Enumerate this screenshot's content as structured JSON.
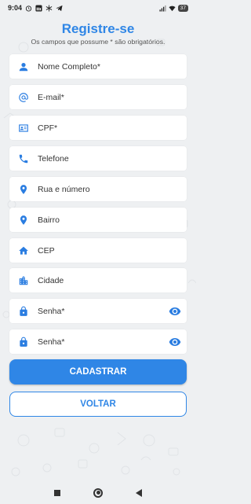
{
  "status_bar": {
    "time": "9:04",
    "left_icons": [
      "alarm-icon",
      "linkedin-icon",
      "snowflake-icon",
      "telegram-icon"
    ],
    "right_icons": [
      "signal-icon",
      "wifi-icon"
    ],
    "battery": "37"
  },
  "header": {
    "title": "Registre-se",
    "subtitle": "Os campos que possume * são obrigatórios."
  },
  "fields": [
    {
      "label": "Nome Completo*",
      "icon": "person-icon"
    },
    {
      "label": "E-mail*",
      "icon": "at-icon"
    },
    {
      "label": "CPF*",
      "icon": "id-card-icon"
    },
    {
      "label": "Telefone",
      "icon": "phone-icon"
    },
    {
      "label": "Rua e número",
      "icon": "location-pin-icon"
    },
    {
      "label": "Bairro",
      "icon": "location-pin-icon"
    },
    {
      "label": "CEP",
      "icon": "home-icon"
    },
    {
      "label": "Cidade",
      "icon": "city-icon"
    },
    {
      "label": "Senha*",
      "icon": "lock-icon",
      "toggle": "eye-icon"
    },
    {
      "label": "Senha*",
      "icon": "lock-icon",
      "toggle": "eye-icon"
    }
  ],
  "buttons": {
    "register": "CADASTRAR",
    "back": "VOLTAR"
  },
  "colors": {
    "accent": "#2f86e6",
    "background": "#eef0f2",
    "field": "#ffffff"
  }
}
